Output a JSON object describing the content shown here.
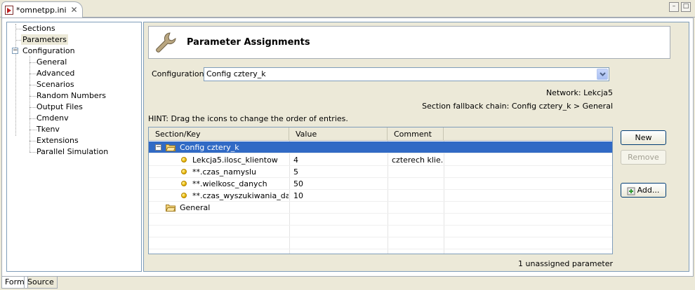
{
  "editor": {
    "tab_title": "*omnetpp.ini",
    "close_glyph": "✕",
    "minimize_glyph": "–",
    "maximize_glyph": "□"
  },
  "tree": {
    "items": [
      {
        "label": "Sections"
      },
      {
        "label": "Parameters"
      },
      {
        "label": "Configuration"
      },
      {
        "label": "General"
      },
      {
        "label": "Advanced"
      },
      {
        "label": "Scenarios"
      },
      {
        "label": "Random Numbers"
      },
      {
        "label": "Output Files"
      },
      {
        "label": "Cmdenv"
      },
      {
        "label": "Tkenv"
      },
      {
        "label": "Extensions"
      },
      {
        "label": "Parallel Simulation"
      }
    ],
    "selected": "Parameters"
  },
  "form": {
    "title": "Parameter Assignments",
    "config_label": "Configuration:",
    "config_value": "Config cztery_k",
    "network_text": "Network: Lekcja5",
    "fallback_text": "Section fallback chain: Config cztery_k > General",
    "hint_text": "HINT: Drag the icons to change the order of entries.",
    "unassigned_text": "1 unassigned parameter"
  },
  "table": {
    "columns": [
      "Section/Key",
      "Value",
      "Comment"
    ],
    "rows": [
      {
        "key": "Config cztery_k",
        "value": "",
        "comment": ""
      },
      {
        "key": "Lekcja5.ilosc_klientow",
        "value": "4",
        "comment": "czterech klie..."
      },
      {
        "key": "**.czas_namyslu",
        "value": "5",
        "comment": ""
      },
      {
        "key": "**.wielkosc_danych",
        "value": "50",
        "comment": ""
      },
      {
        "key": "**.czas_wyszukiwania_danych",
        "value": "10",
        "comment": ""
      },
      {
        "key": "General",
        "value": "",
        "comment": ""
      }
    ]
  },
  "buttons": {
    "new": "New",
    "remove": "Remove",
    "add": "Add..."
  },
  "bottom_tabs": [
    "Form",
    "Source"
  ],
  "colors": {
    "selection": "#316ac5",
    "accent_border": "#7f9db9"
  }
}
